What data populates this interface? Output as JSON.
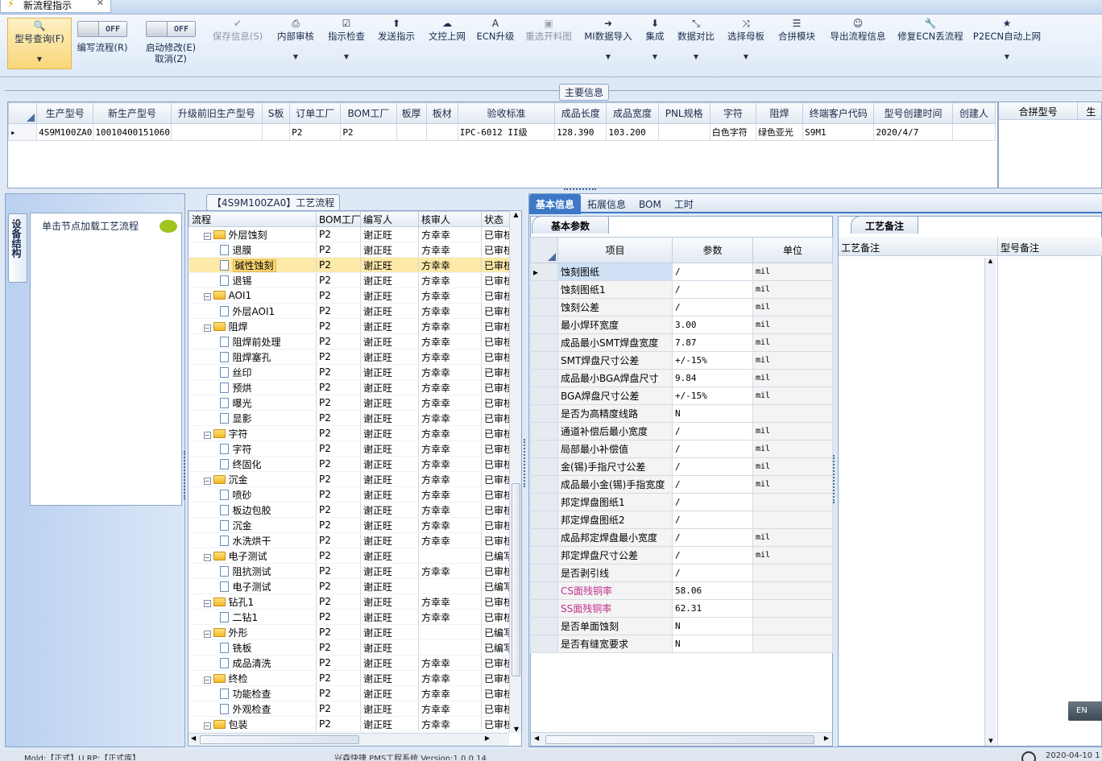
{
  "window": {
    "tab_title": "新流程指示"
  },
  "ribbon": {
    "query_btn": "型号查询(F)",
    "toggle_off": "OFF",
    "write_flow": "编写流程(R)",
    "start_modify": "启动修改(E)",
    "cancel": "取消(Z)",
    "save_info": "保存信息(S)",
    "internal_review": "内部审核",
    "instr_check": "指示检查",
    "send_instr": "发送指示",
    "doc_upload": "文控上网",
    "ecn_upgrade": "ECN升级",
    "reselect_drawing": "重选开料图",
    "mi_import": "MI数据导入",
    "integrate": "集成",
    "data_compare": "数据对比",
    "select_mother": "选择母板",
    "combine_module": "合拼模块",
    "export_flow": "导出流程信息",
    "repair_ecn": "修复ECN丢流程",
    "p2ecn_upload": "P2ECN自动上网"
  },
  "main_info": {
    "title": "主要信息",
    "columns": [
      "生产型号",
      "新生产型号",
      "升级前旧生产型号",
      "S板",
      "订单工厂",
      "BOM工厂",
      "板厚",
      "板材",
      "验收标准",
      "成品长度",
      "成品宽度",
      "PNL规格",
      "字符",
      "阻焊",
      "终端客户代码",
      "型号创建时间",
      "创建人"
    ],
    "row": [
      "4S9M100ZA0",
      "10010400151060",
      "",
      "",
      "P2",
      "P2",
      "",
      "",
      "IPC-6012 II级",
      "128.390",
      "103.200",
      "",
      "白色字符",
      "绿色亚光",
      "S9M1",
      "2020/4/7",
      ""
    ],
    "side_columns": [
      "合拼型号",
      "生"
    ]
  },
  "left_panel": {
    "vertical_tab": "设备结构",
    "load_hint": "单击节点加载工艺流程"
  },
  "flow": {
    "title": "【4S9M100ZA0】工艺流程",
    "columns": [
      "流程",
      "BOM工厂",
      "编写人",
      "核审人",
      "状态"
    ],
    "rows": [
      {
        "name": "外层蚀刻",
        "level": 0,
        "bom": "P2",
        "writer": "谢正旺",
        "reviewer": "方幸幸",
        "status": "已审核"
      },
      {
        "name": "退膜",
        "level": 1,
        "bom": "P2",
        "writer": "谢正旺",
        "reviewer": "方幸幸",
        "status": "已审核"
      },
      {
        "name": "碱性蚀刻",
        "level": 1,
        "bom": "P2",
        "writer": "谢正旺",
        "reviewer": "方幸幸",
        "status": "已审核"
      },
      {
        "name": "退锡",
        "level": 1,
        "bom": "P2",
        "writer": "谢正旺",
        "reviewer": "方幸幸",
        "status": "已审核"
      },
      {
        "name": "AOI1",
        "level": 0,
        "bom": "P2",
        "writer": "谢正旺",
        "reviewer": "方幸幸",
        "status": "已审核"
      },
      {
        "name": "外层AOI1",
        "level": 1,
        "bom": "P2",
        "writer": "谢正旺",
        "reviewer": "方幸幸",
        "status": "已审核"
      },
      {
        "name": "阻焊",
        "level": 0,
        "bom": "P2",
        "writer": "谢正旺",
        "reviewer": "方幸幸",
        "status": "已审核"
      },
      {
        "name": "阻焊前处理",
        "level": 1,
        "bom": "P2",
        "writer": "谢正旺",
        "reviewer": "方幸幸",
        "status": "已审核"
      },
      {
        "name": "阻焊塞孔",
        "level": 1,
        "bom": "P2",
        "writer": "谢正旺",
        "reviewer": "方幸幸",
        "status": "已审核"
      },
      {
        "name": "丝印",
        "level": 1,
        "bom": "P2",
        "writer": "谢正旺",
        "reviewer": "方幸幸",
        "status": "已审核"
      },
      {
        "name": "预烘",
        "level": 1,
        "bom": "P2",
        "writer": "谢正旺",
        "reviewer": "方幸幸",
        "status": "已审核"
      },
      {
        "name": "曝光",
        "level": 1,
        "bom": "P2",
        "writer": "谢正旺",
        "reviewer": "方幸幸",
        "status": "已审核"
      },
      {
        "name": "显影",
        "level": 1,
        "bom": "P2",
        "writer": "谢正旺",
        "reviewer": "方幸幸",
        "status": "已审核"
      },
      {
        "name": "字符",
        "level": 0,
        "bom": "P2",
        "writer": "谢正旺",
        "reviewer": "方幸幸",
        "status": "已审核"
      },
      {
        "name": "字符",
        "level": 1,
        "bom": "P2",
        "writer": "谢正旺",
        "reviewer": "方幸幸",
        "status": "已审核"
      },
      {
        "name": "终固化",
        "level": 1,
        "bom": "P2",
        "writer": "谢正旺",
        "reviewer": "方幸幸",
        "status": "已审核"
      },
      {
        "name": "沉金",
        "level": 0,
        "bom": "P2",
        "writer": "谢正旺",
        "reviewer": "方幸幸",
        "status": "已审核"
      },
      {
        "name": "喷砂",
        "level": 1,
        "bom": "P2",
        "writer": "谢正旺",
        "reviewer": "方幸幸",
        "status": "已审核"
      },
      {
        "name": "板边包胶",
        "level": 1,
        "bom": "P2",
        "writer": "谢正旺",
        "reviewer": "方幸幸",
        "status": "已审核"
      },
      {
        "name": "沉金",
        "level": 1,
        "bom": "P2",
        "writer": "谢正旺",
        "reviewer": "方幸幸",
        "status": "已审核"
      },
      {
        "name": "水洗烘干",
        "level": 1,
        "bom": "P2",
        "writer": "谢正旺",
        "reviewer": "方幸幸",
        "status": "已审核"
      },
      {
        "name": "电子测试",
        "level": 0,
        "bom": "P2",
        "writer": "谢正旺",
        "reviewer": "",
        "status": "已编写"
      },
      {
        "name": "阻抗测试",
        "level": 1,
        "bom": "P2",
        "writer": "谢正旺",
        "reviewer": "方幸幸",
        "status": "已审核"
      },
      {
        "name": "电子测试",
        "level": 1,
        "bom": "P2",
        "writer": "谢正旺",
        "reviewer": "",
        "status": "已编写"
      },
      {
        "name": "钻孔1",
        "level": 0,
        "bom": "P2",
        "writer": "谢正旺",
        "reviewer": "方幸幸",
        "status": "已审核"
      },
      {
        "name": "二钻1",
        "level": 1,
        "bom": "P2",
        "writer": "谢正旺",
        "reviewer": "方幸幸",
        "status": "已审核"
      },
      {
        "name": "外形",
        "level": 0,
        "bom": "P2",
        "writer": "谢正旺",
        "reviewer": "",
        "status": "已编写"
      },
      {
        "name": "铣板",
        "level": 1,
        "bom": "P2",
        "writer": "谢正旺",
        "reviewer": "",
        "status": "已编写"
      },
      {
        "name": "成品清洗",
        "level": 1,
        "bom": "P2",
        "writer": "谢正旺",
        "reviewer": "方幸幸",
        "status": "已审核"
      },
      {
        "name": "终检",
        "level": 0,
        "bom": "P2",
        "writer": "谢正旺",
        "reviewer": "方幸幸",
        "status": "已审核"
      },
      {
        "name": "功能检查",
        "level": 1,
        "bom": "P2",
        "writer": "谢正旺",
        "reviewer": "方幸幸",
        "status": "已审核"
      },
      {
        "name": "外观检查",
        "level": 1,
        "bom": "P2",
        "writer": "谢正旺",
        "reviewer": "方幸幸",
        "status": "已审核"
      },
      {
        "name": "包装",
        "level": 0,
        "bom": "P2",
        "writer": "谢正旺",
        "reviewer": "方幸幸",
        "status": "已审核"
      }
    ],
    "selected_index": 2
  },
  "detail_tabs": [
    "基本信息",
    "拓展信息",
    "BOM",
    "工时"
  ],
  "params": {
    "title": "基本参数",
    "columns": [
      "项目",
      "参数",
      "单位"
    ],
    "rows": [
      {
        "item": "蚀刻图纸",
        "value": "/",
        "unit": "mil"
      },
      {
        "item": "蚀刻图纸1",
        "value": "/",
        "unit": "mil"
      },
      {
        "item": "蚀刻公差",
        "value": "/",
        "unit": "mil"
      },
      {
        "item": "最小焊环宽度",
        "value": "3.00",
        "unit": "mil"
      },
      {
        "item": "成品最小SMT焊盘宽度",
        "value": "7.87",
        "unit": "mil"
      },
      {
        "item": "SMT焊盘尺寸公差",
        "value": "+/-15%",
        "unit": "mil"
      },
      {
        "item": "成品最小BGA焊盘尺寸",
        "value": "9.84",
        "unit": "mil"
      },
      {
        "item": "BGA焊盘尺寸公差",
        "value": "+/-15%",
        "unit": "mil"
      },
      {
        "item": "是否为高精度线路",
        "value": "N",
        "unit": ""
      },
      {
        "item": "通道补偿后最小宽度",
        "value": "/",
        "unit": "mil"
      },
      {
        "item": "局部最小补偿值",
        "value": "/",
        "unit": "mil"
      },
      {
        "item": "金(锡)手指尺寸公差",
        "value": "/",
        "unit": "mil"
      },
      {
        "item": "成品最小金(锡)手指宽度",
        "value": "/",
        "unit": "mil"
      },
      {
        "item": "邦定焊盘图纸1",
        "value": "/",
        "unit": ""
      },
      {
        "item": "邦定焊盘图纸2",
        "value": "/",
        "unit": ""
      },
      {
        "item": "成品邦定焊盘最小宽度",
        "value": "/",
        "unit": "mil"
      },
      {
        "item": "邦定焊盘尺寸公差",
        "value": "/",
        "unit": "mil"
      },
      {
        "item": "是否剥引线",
        "value": "/",
        "unit": ""
      },
      {
        "item": "CS面残铜率",
        "value": "58.06",
        "unit": "",
        "highlight": true
      },
      {
        "item": "SS面残铜率",
        "value": "62.31",
        "unit": "",
        "highlight": true
      },
      {
        "item": "是否单面蚀刻",
        "value": "N",
        "unit": ""
      },
      {
        "item": "是否有缝宽要求",
        "value": "N",
        "unit": ""
      }
    ]
  },
  "notes": {
    "title": "工艺备注",
    "col1": "工艺备注",
    "col2": "型号备注"
  },
  "status_bar": {
    "left": "Mold:【正式】U RP:【正式库】",
    "center": "兴森快捷 PMS工程系统 Version:1.0.0.14",
    "right": "2020-04-10 1",
    "lang": "EN"
  },
  "colors": {
    "accent": "#3d78c7",
    "highlight_text": "#c0308a",
    "selected": "#fde9a8"
  }
}
